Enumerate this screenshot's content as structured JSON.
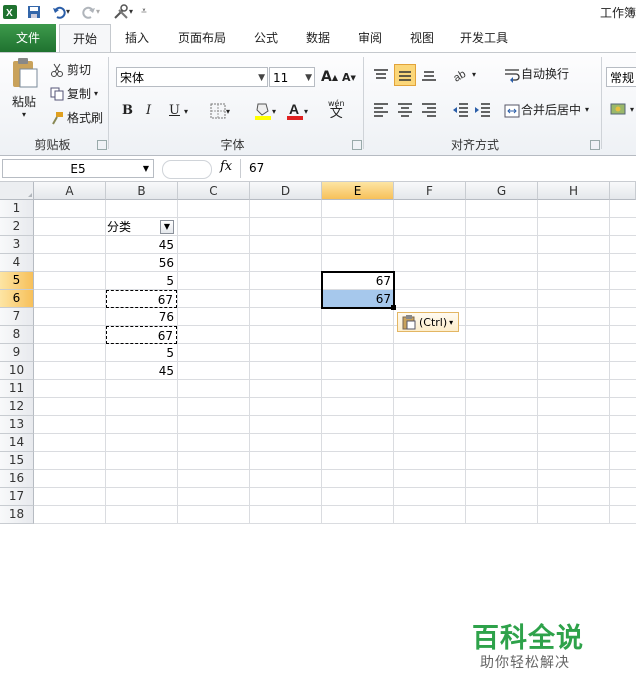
{
  "window": {
    "title": "工作簿"
  },
  "quick_access": {
    "icons": [
      "excel-logo-icon",
      "save-icon",
      "undo-icon",
      "redo-icon",
      "tools-icon",
      "customize-icon"
    ]
  },
  "tabs": [
    {
      "label": "文件",
      "key": "file"
    },
    {
      "label": "开始",
      "key": "home"
    },
    {
      "label": "插入",
      "key": "insert"
    },
    {
      "label": "页面布局",
      "key": "layout"
    },
    {
      "label": "公式",
      "key": "formulas"
    },
    {
      "label": "数据",
      "key": "data"
    },
    {
      "label": "审阅",
      "key": "review"
    },
    {
      "label": "视图",
      "key": "view"
    },
    {
      "label": "开发工具",
      "key": "dev"
    }
  ],
  "ribbon": {
    "clipboard": {
      "paste": "粘贴",
      "cut": "剪切",
      "copy": "复制",
      "format_painter": "格式刷",
      "group": "剪贴板"
    },
    "font": {
      "name": "宋体",
      "size": "11",
      "bold": "B",
      "italic": "I",
      "underline": "U",
      "group": "字体",
      "wen": "wén",
      "wen_char": "文"
    },
    "align": {
      "wrap": "自动换行",
      "merge": "合并后居中",
      "group": "对齐方式"
    },
    "number": {
      "format": "常规"
    }
  },
  "formula_bar": {
    "name_box": "E5",
    "fx": "fx",
    "value": "67"
  },
  "columns": [
    "A",
    "B",
    "C",
    "D",
    "E",
    "F",
    "G",
    "H"
  ],
  "rows": [
    "1",
    "2",
    "3",
    "4",
    "5",
    "6",
    "7",
    "8",
    "9",
    "10",
    "11",
    "12",
    "13",
    "14",
    "15",
    "16",
    "17",
    "18"
  ],
  "cells": {
    "B2": "分类",
    "B3": "45",
    "B4": "56",
    "B5": "5",
    "B6": "67",
    "B7": "76",
    "B8": "67",
    "B9": "5",
    "B10": "45",
    "E5": "67",
    "E6": "67"
  },
  "paste_options": {
    "label": "(Ctrl)"
  },
  "watermark": {
    "title": "百科全说",
    "subtitle": "助你轻松解决"
  },
  "colors": {
    "file_tab": "#1f7230",
    "selection_fill": "#a6c8ec",
    "header_selected": "#f7c05a",
    "watermark": "#2ea24a"
  }
}
